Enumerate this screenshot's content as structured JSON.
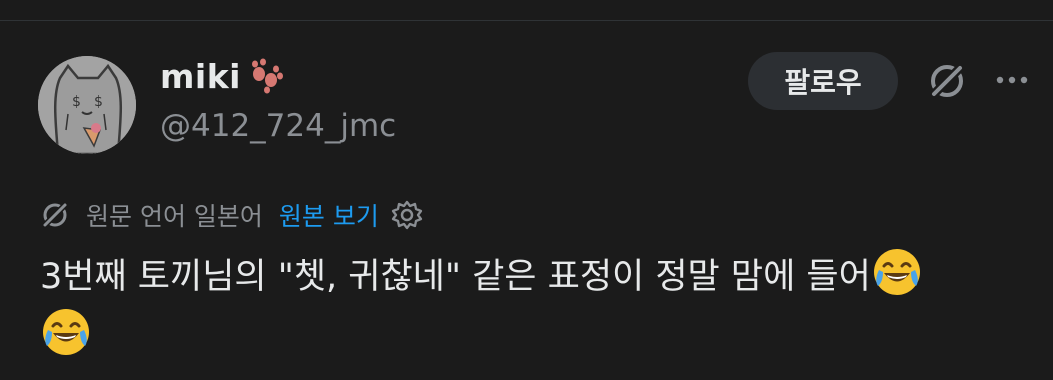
{
  "user": {
    "display_name": "miki",
    "handle": "@412_724_jmc"
  },
  "actions": {
    "follow_label": "팔로우"
  },
  "translation": {
    "source_lang_text": "원문 언어 일본어",
    "show_original_label": "원본 보기"
  },
  "tweet": {
    "text": "3번째 토끼님의 \"쳇, 귀찮네\" 같은 표정이 정말 맘에 들어"
  },
  "icons": [
    "paw-icon",
    "grok-icon",
    "more-icon",
    "settings-icon",
    "laughing-crying-emoji"
  ],
  "colors": {
    "background": "#1b1b1b",
    "link": "#1d9bf0",
    "secondary_text": "#8b8f94",
    "button_bg": "#2c2f33"
  }
}
